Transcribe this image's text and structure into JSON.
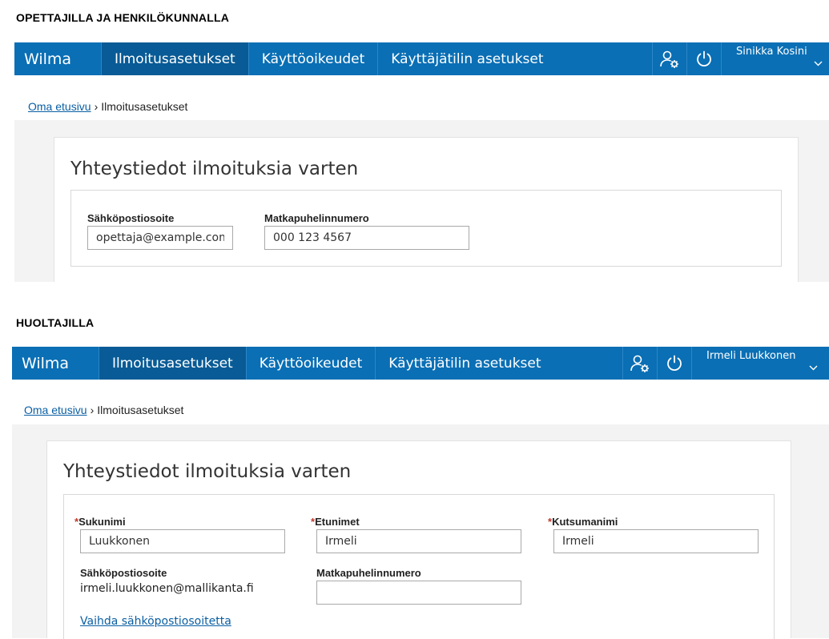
{
  "sections": {
    "staff_heading": "OPETTAJILLA JA HENKILÖKUNNALLA",
    "guardian_heading": "HUOLTAJILLA"
  },
  "staff": {
    "nav": {
      "brand": "Wilma",
      "items": [
        "Ilmoitusasetukset",
        "Käyttöoikeudet",
        "Käyttäjätilin asetukset"
      ],
      "active_index": 0,
      "user_name": "Sinikka Kosini",
      "icons": [
        "user-settings-icon",
        "power-icon",
        "chevron-down-icon"
      ]
    },
    "breadcrumb": {
      "home": "Oma etusivu",
      "separator": "›",
      "current": "Ilmoitusasetukset"
    },
    "card_title": "Yhteystiedot ilmoituksia varten",
    "email_label": "Sähköpostiosoite",
    "email_value": "opettaja@example.com",
    "phone_label": "Matkapuhelinnumero",
    "phone_value": "000 123 4567"
  },
  "guardian": {
    "nav": {
      "brand": "Wilma",
      "items": [
        "Ilmoitusasetukset",
        "Käyttöoikeudet",
        "Käyttäjätilin asetukset"
      ],
      "active_index": 0,
      "user_name": "Irmeli Luukkonen",
      "icons": [
        "user-settings-icon",
        "power-icon",
        "chevron-down-icon"
      ]
    },
    "breadcrumb": {
      "home": "Oma etusivu",
      "separator": "›",
      "current": "Ilmoitusasetukset"
    },
    "card_title": "Yhteystiedot ilmoituksia varten",
    "required_marker": "*",
    "lastname_label": "Sukunimi",
    "lastname_value": "Luukkonen",
    "firstnames_label": "Etunimet",
    "firstnames_value": "Irmeli",
    "nickname_label": "Kutsumanimi",
    "nickname_value": "Irmeli",
    "email_label": "Sähköpostiosoite",
    "email_value": "irmeli.luukkonen@mallikanta.fi",
    "phone_label": "Matkapuhelinnumero",
    "phone_value": "",
    "change_email_link": "Vaihda sähköpostiosoitetta"
  },
  "colors": {
    "navbar": "#0a6fb5",
    "navbar_active": "#085b96",
    "link": "#0a5fa3",
    "required": "#c0392b"
  }
}
